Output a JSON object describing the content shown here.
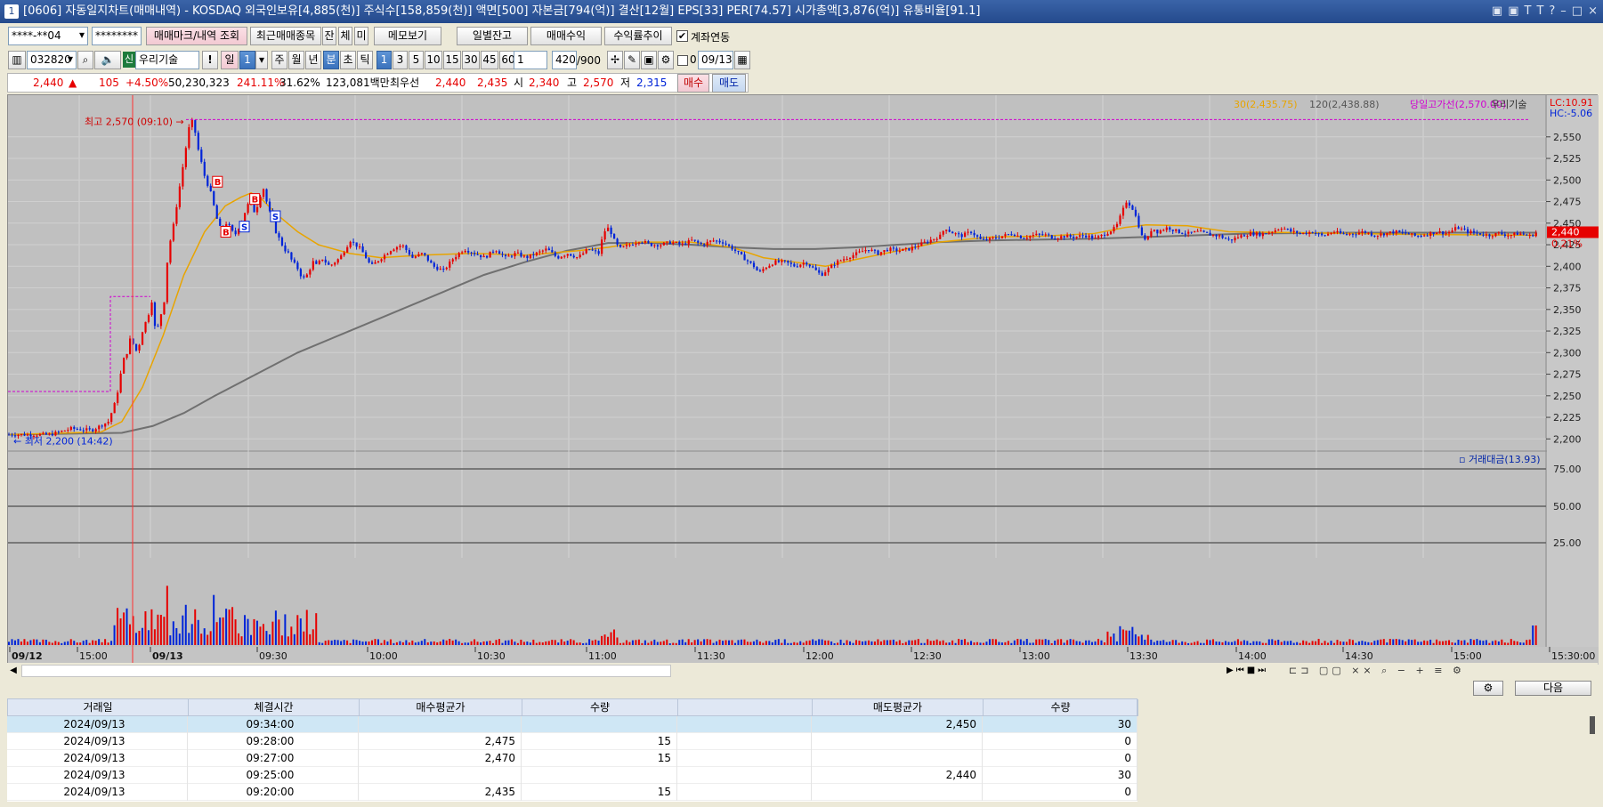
{
  "window": {
    "number": "1",
    "title": "[0606] 자동일지차트(매매내역) - KOSDAQ 외국인보유[4,885(천)] 주식수[158,859(천)] 액면[500] 자본금[794(억)] 결산[12월] EPS[33] PER[74.57] 시가총액[3,876(억)] 유통비율[91.1]",
    "controls": [
      "▣",
      "▣",
      "T",
      "T",
      "?",
      "–",
      "□",
      "×"
    ]
  },
  "toolbar1": {
    "account": "****-**04",
    "password": "********",
    "btn_mark": "매매마크/내역 조회",
    "btn_recent": "최근매매종목",
    "btn_jan": "잔",
    "btn_che": "체",
    "btn_mi": "미",
    "btn_memo": "메모보기",
    "btn_daily": "일별잔고",
    "btn_profit": "매매수익",
    "btn_trend": "수익률추이",
    "checkbox_link": "계좌연동",
    "checkbox_link_checked": true
  },
  "toolbar2": {
    "code": "032820",
    "market_badge": "신",
    "stock_name": "우리기술",
    "exclaim": "!",
    "period_il": "일",
    "period_value": "1",
    "periods": [
      "주",
      "월",
      "년",
      "분",
      "초",
      "틱"
    ],
    "intervals": [
      "1",
      "3",
      "5",
      "10",
      "15",
      "30",
      "45",
      "60"
    ],
    "interval_value": "1",
    "count": "420",
    "count_max": "/900",
    "date_flag": "0",
    "date": "09/13"
  },
  "quote": {
    "price": "2,440",
    "change": "105",
    "change_pct": "+4.50%",
    "volume": "50,230,323",
    "volume_pct": "241.11%",
    "turnover": "31.62%",
    "amount": "123,081백만",
    "best_label": "최우선",
    "best_sell": "2,440",
    "best_buy": "2,435",
    "open_label": "시",
    "open": "2,340",
    "high_label": "고",
    "high": "2,570",
    "low_label": "저",
    "low": "2,315",
    "buy_btn": "매수",
    "sell_btn": "매도"
  },
  "chart_data": {
    "type": "candlestick",
    "legend": {
      "ma30": "30(2,435.75)",
      "ma120": "120(2,438.88)",
      "high_line": "당일고가선(2,570.00)",
      "name": "우리기술",
      "lc": "LC:10.91",
      "hc": "HC:-5.06"
    },
    "colors": {
      "up": "#e60000",
      "down": "#0024d8",
      "ma30": "#e8a400",
      "ma120": "#707070",
      "high_line": "#d000d0"
    },
    "y_ticks": [
      "2,550",
      "2,525",
      "2,500",
      "2,475",
      "2,450",
      "2,425",
      "2,400",
      "2,375",
      "2,350",
      "2,325",
      "2,300",
      "2,275",
      "2,250",
      "2,225",
      "2,200"
    ],
    "y_range": [
      2190,
      2590
    ],
    "current_price": "2,440",
    "current_pct": "0.21%",
    "high_annotation": "최고 2,570 (09:10)",
    "low_annotation": "최저 2,200 (14:42)",
    "trade_marks": [
      "B",
      "B",
      "B",
      "S",
      "S"
    ],
    "volume_panel": {
      "label": "거래대금(13.93)",
      "y_ticks": [
        "75.00",
        "50.00",
        "25.00"
      ]
    },
    "x_labels": [
      "09/12",
      "15:00",
      "09/13",
      "09:30",
      "10:00",
      "10:30",
      "11:00",
      "11:30",
      "12:00",
      "12:30",
      "13:00",
      "13:30",
      "14:00",
      "14:30",
      "15:00",
      "15:30:00"
    ],
    "price_path": [
      [
        0,
        2205
      ],
      [
        40,
        2205
      ],
      [
        60,
        2212
      ],
      [
        80,
        2210
      ],
      [
        96,
        2220
      ],
      [
        102,
        2240
      ],
      [
        106,
        2260
      ],
      [
        110,
        2290
      ],
      [
        114,
        2300
      ],
      [
        118,
        2320
      ],
      [
        122,
        2300
      ],
      [
        126,
        2310
      ],
      [
        130,
        2330
      ],
      [
        134,
        2340
      ],
      [
        138,
        2360
      ],
      [
        142,
        2320
      ],
      [
        146,
        2340
      ],
      [
        150,
        2360
      ],
      [
        154,
        2420
      ],
      [
        158,
        2440
      ],
      [
        162,
        2470
      ],
      [
        166,
        2500
      ],
      [
        170,
        2530
      ],
      [
        174,
        2560
      ],
      [
        178,
        2570
      ],
      [
        182,
        2540
      ],
      [
        186,
        2520
      ],
      [
        190,
        2500
      ],
      [
        194,
        2490
      ],
      [
        198,
        2470
      ],
      [
        202,
        2450
      ],
      [
        206,
        2440
      ],
      [
        210,
        2450
      ],
      [
        214,
        2445
      ],
      [
        218,
        2435
      ],
      [
        222,
        2445
      ],
      [
        226,
        2455
      ],
      [
        230,
        2470
      ],
      [
        234,
        2475
      ],
      [
        238,
        2460
      ],
      [
        242,
        2480
      ],
      [
        246,
        2490
      ],
      [
        250,
        2470
      ],
      [
        254,
        2455
      ],
      [
        258,
        2440
      ],
      [
        262,
        2430
      ],
      [
        266,
        2420
      ],
      [
        270,
        2415
      ],
      [
        274,
        2405
      ],
      [
        278,
        2400
      ],
      [
        282,
        2390
      ],
      [
        286,
        2385
      ],
      [
        290,
        2395
      ],
      [
        294,
        2405
      ],
      [
        298,
        2400
      ],
      [
        302,
        2410
      ],
      [
        310,
        2400
      ],
      [
        320,
        2410
      ],
      [
        330,
        2430
      ],
      [
        340,
        2420
      ],
      [
        350,
        2400
      ],
      [
        360,
        2410
      ],
      [
        370,
        2420
      ],
      [
        380,
        2425
      ],
      [
        390,
        2410
      ],
      [
        400,
        2415
      ],
      [
        410,
        2400
      ],
      [
        420,
        2395
      ],
      [
        430,
        2410
      ],
      [
        440,
        2420
      ],
      [
        450,
        2415
      ],
      [
        460,
        2410
      ],
      [
        470,
        2420
      ],
      [
        480,
        2410
      ],
      [
        490,
        2415
      ],
      [
        500,
        2410
      ],
      [
        510,
        2415
      ],
      [
        520,
        2420
      ],
      [
        530,
        2410
      ],
      [
        540,
        2415
      ],
      [
        550,
        2410
      ],
      [
        560,
        2420
      ],
      [
        570,
        2415
      ],
      [
        575,
        2440
      ],
      [
        580,
        2445
      ],
      [
        585,
        2430
      ],
      [
        590,
        2420
      ],
      [
        600,
        2425
      ],
      [
        610,
        2430
      ],
      [
        620,
        2425
      ],
      [
        630,
        2425
      ],
      [
        640,
        2428
      ],
      [
        650,
        2425
      ],
      [
        660,
        2430
      ],
      [
        670,
        2425
      ],
      [
        680,
        2430
      ],
      [
        690,
        2428
      ],
      [
        700,
        2420
      ],
      [
        710,
        2410
      ],
      [
        720,
        2400
      ],
      [
        725,
        2392
      ],
      [
        730,
        2398
      ],
      [
        740,
        2405
      ],
      [
        750,
        2405
      ],
      [
        760,
        2400
      ],
      [
        770,
        2405
      ],
      [
        780,
        2395
      ],
      [
        785,
        2390
      ],
      [
        790,
        2395
      ],
      [
        800,
        2405
      ],
      [
        810,
        2410
      ],
      [
        820,
        2415
      ],
      [
        830,
        2420
      ],
      [
        840,
        2415
      ],
      [
        850,
        2420
      ],
      [
        860,
        2418
      ],
      [
        870,
        2420
      ],
      [
        880,
        2425
      ],
      [
        890,
        2430
      ],
      [
        900,
        2435
      ],
      [
        905,
        2445
      ],
      [
        910,
        2440
      ],
      [
        920,
        2435
      ],
      [
        930,
        2440
      ],
      [
        940,
        2430
      ],
      [
        950,
        2432
      ],
      [
        960,
        2435
      ],
      [
        970,
        2438
      ],
      [
        980,
        2433
      ],
      [
        990,
        2436
      ],
      [
        1000,
        2437
      ],
      [
        1010,
        2433
      ],
      [
        1020,
        2435
      ],
      [
        1030,
        2434
      ],
      [
        1040,
        2436
      ],
      [
        1050,
        2432
      ],
      [
        1060,
        2438
      ],
      [
        1070,
        2445
      ],
      [
        1075,
        2460
      ],
      [
        1080,
        2475
      ],
      [
        1085,
        2470
      ],
      [
        1090,
        2455
      ],
      [
        1095,
        2435
      ],
      [
        1100,
        2430
      ],
      [
        1105,
        2445
      ],
      [
        1110,
        2440
      ],
      [
        1120,
        2445
      ],
      [
        1130,
        2440
      ],
      [
        1140,
        2438
      ],
      [
        1150,
        2440
      ],
      [
        1160,
        2437
      ],
      [
        1170,
        2435
      ],
      [
        1180,
        2430
      ],
      [
        1190,
        2435
      ],
      [
        1200,
        2438
      ],
      [
        1210,
        2437
      ],
      [
        1220,
        2440
      ],
      [
        1230,
        2445
      ],
      [
        1240,
        2440
      ],
      [
        1250,
        2438
      ],
      [
        1260,
        2440
      ],
      [
        1270,
        2435
      ],
      [
        1280,
        2440
      ],
      [
        1290,
        2437
      ],
      [
        1300,
        2438
      ],
      [
        1310,
        2440
      ],
      [
        1320,
        2436
      ],
      [
        1330,
        2438
      ],
      [
        1340,
        2440
      ],
      [
        1350,
        2438
      ],
      [
        1360,
        2435
      ],
      [
        1370,
        2437
      ],
      [
        1380,
        2440
      ],
      [
        1390,
        2438
      ],
      [
        1400,
        2445
      ],
      [
        1410,
        2440
      ],
      [
        1420,
        2438
      ],
      [
        1430,
        2436
      ],
      [
        1440,
        2438
      ],
      [
        1450,
        2436
      ],
      [
        1460,
        2438
      ],
      [
        1470,
        2435
      ],
      [
        1478,
        2440
      ]
    ],
    "ma30_path": [
      [
        0,
        2205
      ],
      [
        90,
        2208
      ],
      [
        110,
        2220
      ],
      [
        130,
        2260
      ],
      [
        150,
        2320
      ],
      [
        170,
        2390
      ],
      [
        190,
        2440
      ],
      [
        210,
        2470
      ],
      [
        225,
        2480
      ],
      [
        235,
        2485
      ],
      [
        245,
        2478
      ],
      [
        260,
        2460
      ],
      [
        280,
        2440
      ],
      [
        300,
        2425
      ],
      [
        330,
        2415
      ],
      [
        360,
        2410
      ],
      [
        400,
        2413
      ],
      [
        450,
        2415
      ],
      [
        500,
        2413
      ],
      [
        550,
        2418
      ],
      [
        580,
        2422
      ],
      [
        610,
        2428
      ],
      [
        660,
        2428
      ],
      [
        700,
        2422
      ],
      [
        730,
        2410
      ],
      [
        760,
        2405
      ],
      [
        790,
        2400
      ],
      [
        820,
        2408
      ],
      [
        860,
        2418
      ],
      [
        900,
        2428
      ],
      [
        950,
        2434
      ],
      [
        1000,
        2435
      ],
      [
        1050,
        2438
      ],
      [
        1080,
        2445
      ],
      [
        1100,
        2448
      ],
      [
        1140,
        2447
      ],
      [
        1180,
        2440
      ],
      [
        1250,
        2439
      ],
      [
        1350,
        2437
      ],
      [
        1478,
        2436
      ]
    ],
    "ma120_path": [
      [
        0,
        2205
      ],
      [
        110,
        2207
      ],
      [
        140,
        2215
      ],
      [
        170,
        2230
      ],
      [
        200,
        2250
      ],
      [
        240,
        2275
      ],
      [
        280,
        2300
      ],
      [
        330,
        2325
      ],
      [
        380,
        2350
      ],
      [
        420,
        2370
      ],
      [
        460,
        2390
      ],
      [
        500,
        2405
      ],
      [
        540,
        2418
      ],
      [
        580,
        2427
      ],
      [
        620,
        2427
      ],
      [
        660,
        2425
      ],
      [
        700,
        2422
      ],
      [
        740,
        2420
      ],
      [
        780,
        2420
      ],
      [
        820,
        2422
      ],
      [
        860,
        2425
      ],
      [
        900,
        2428
      ],
      [
        950,
        2430
      ],
      [
        1000,
        2431
      ],
      [
        1050,
        2432
      ],
      [
        1100,
        2434
      ],
      [
        1150,
        2436
      ],
      [
        1200,
        2438
      ],
      [
        1300,
        2439
      ],
      [
        1478,
        2439
      ]
    ]
  },
  "grid": {
    "headers": [
      "거래일",
      "체결시간",
      "매수평균가",
      "수량",
      "",
      "매도평균가",
      "수량"
    ],
    "rows": [
      [
        "2024/09/13",
        "09:34:00",
        "",
        "",
        "",
        "2,450",
        "30"
      ],
      [
        "2024/09/13",
        "09:28:00",
        "2,475",
        "15",
        "",
        "",
        "0"
      ],
      [
        "2024/09/13",
        "09:27:00",
        "2,470",
        "15",
        "",
        "",
        "0"
      ],
      [
        "2024/09/13",
        "09:25:00",
        "",
        "",
        "",
        "2,440",
        "30"
      ],
      [
        "2024/09/13",
        "09:20:00",
        "2,435",
        "15",
        "",
        "",
        "0"
      ]
    ],
    "next_btn": "다음"
  }
}
